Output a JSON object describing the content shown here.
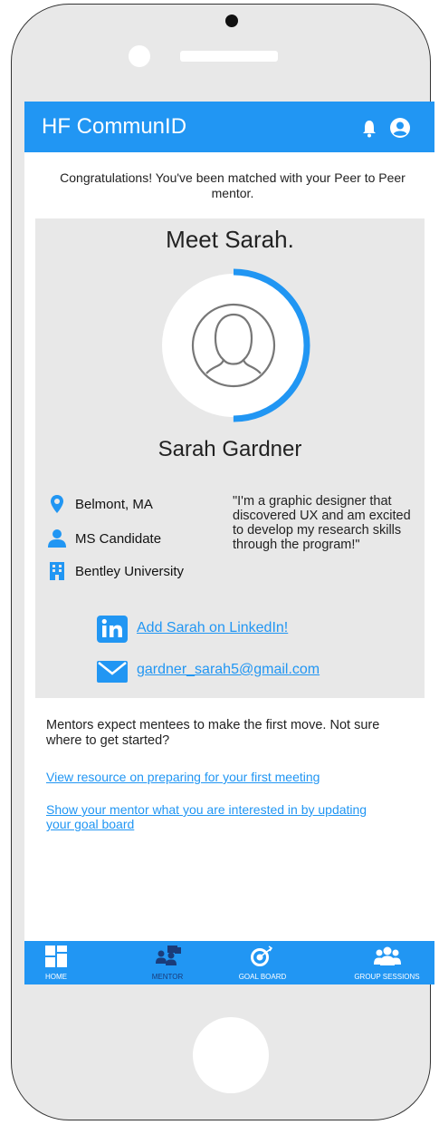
{
  "app": {
    "title": "HF CommunID"
  },
  "match": {
    "message": "Congratulations! You've been matched with your Peer to Peer mentor.",
    "heading": "Meet Sarah.",
    "progress_fraction": 0.5
  },
  "mentor": {
    "name": "Sarah Gardner",
    "location": "Belmont, MA",
    "role": "MS Candidate",
    "school": "Bentley University",
    "quote": "\"I'm a graphic designer that discovered UX and am excited to develop my research skills through the program!\"",
    "linkedin_label": "Add Sarah on LinkedIn!",
    "email": "gardner_sarah5@gmail.com"
  },
  "guidance": {
    "text": "Mentors expect mentees to make the first move. Not sure where to get started?",
    "link_resource": "View resource on preparing for your first meeting",
    "link_goal_board": "Show your mentor what you are interested in by updating your goal board"
  },
  "nav": {
    "items": [
      {
        "label": "HOME",
        "icon": "home-icon",
        "active": false
      },
      {
        "label": "MENTOR",
        "icon": "mentor-icon",
        "active": true
      },
      {
        "label": "GOAL BOARD",
        "icon": "goal-board-icon",
        "active": false
      },
      {
        "label": "GROUP SESSIONS",
        "icon": "group-sessions-icon",
        "active": false
      }
    ]
  },
  "colors": {
    "accent": "#2196f3",
    "card": "#e8e8e8",
    "active_tab": "#1a3c7a"
  }
}
